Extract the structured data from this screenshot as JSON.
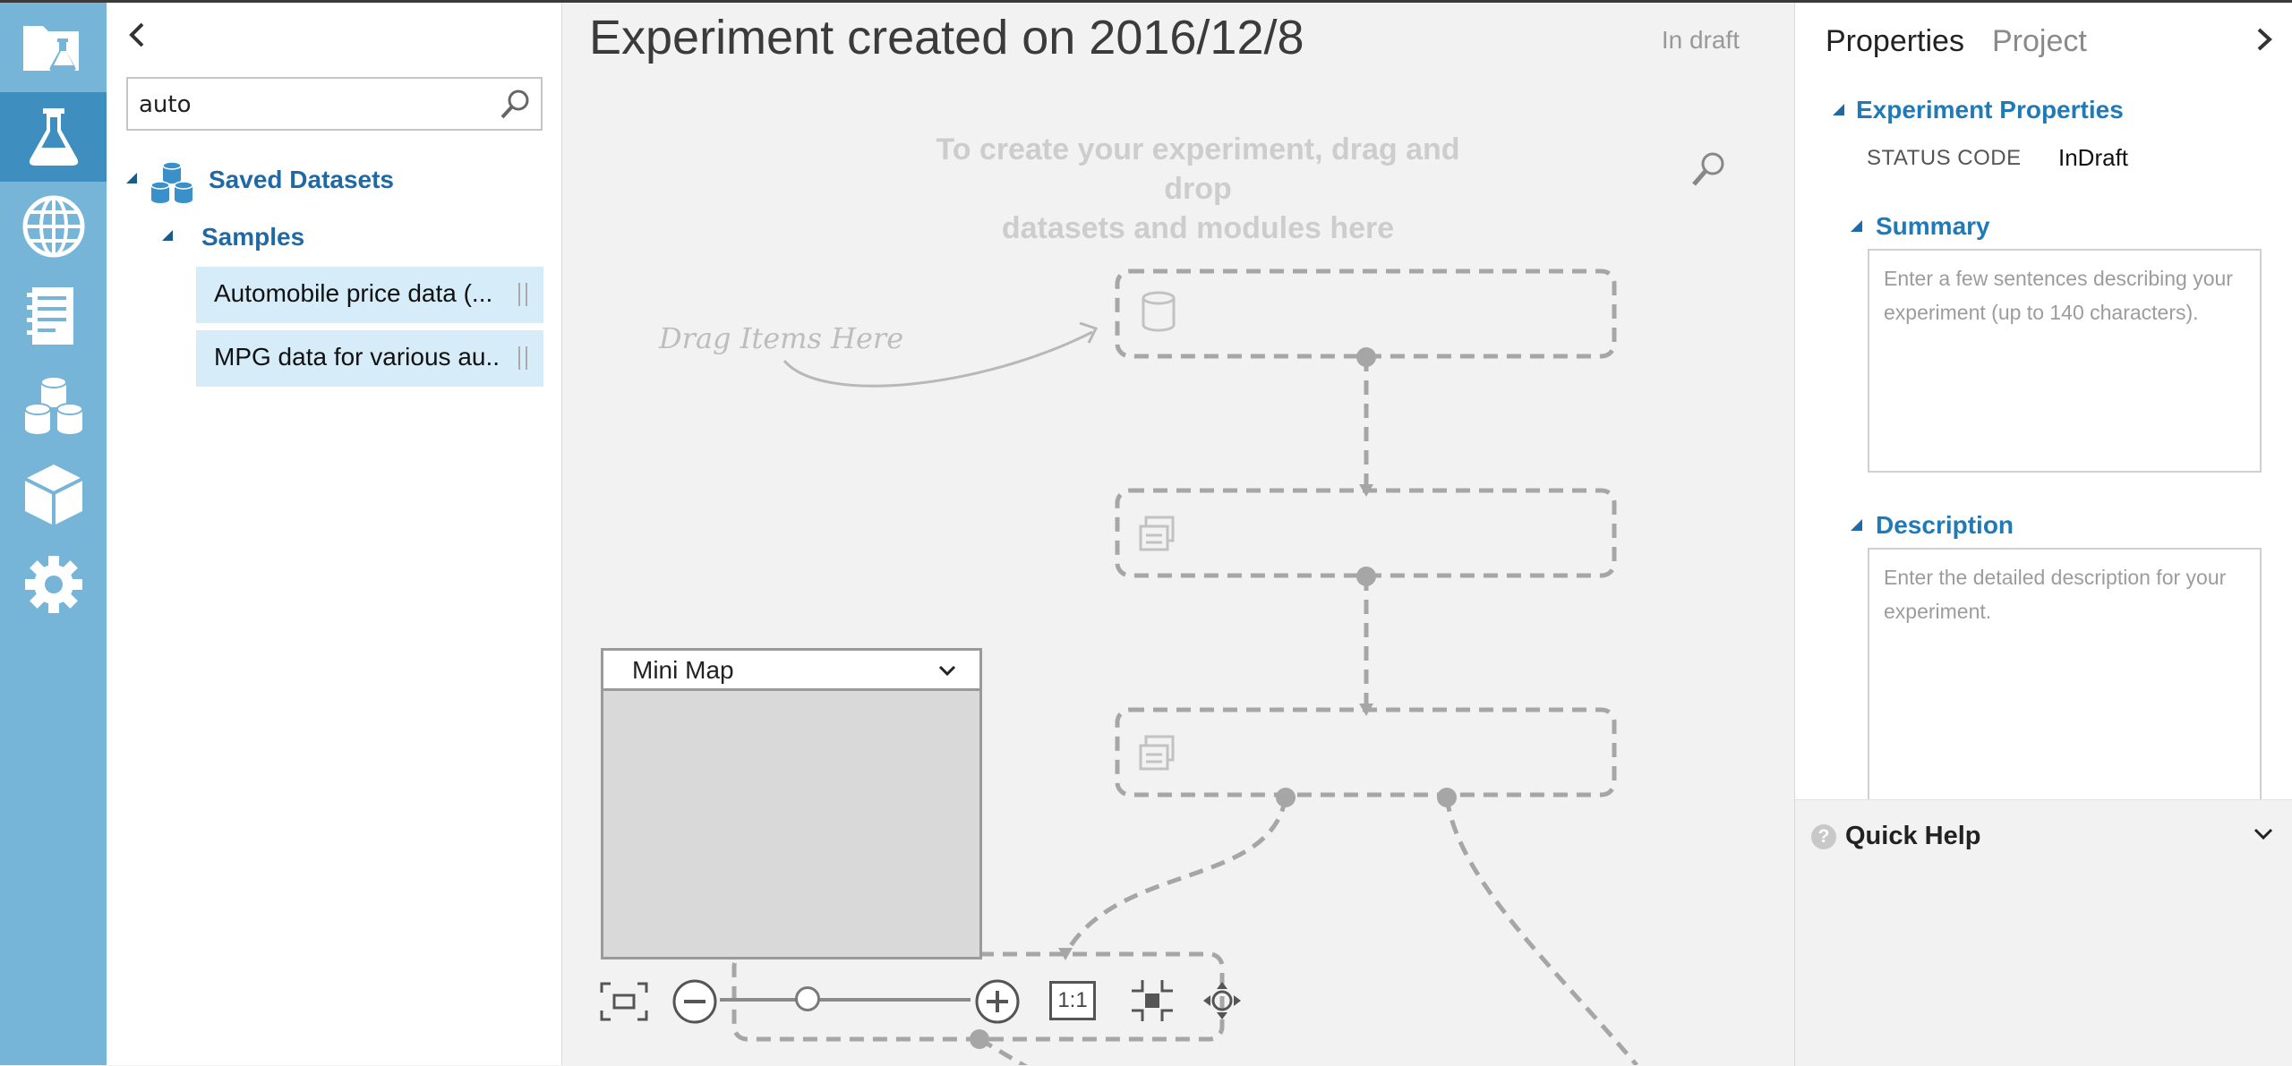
{
  "nav": {
    "items": [
      {
        "icon": "projects-icon"
      },
      {
        "icon": "experiments-icon",
        "active": true
      },
      {
        "icon": "web-services-icon"
      },
      {
        "icon": "notebooks-icon"
      },
      {
        "icon": "datasets-icon"
      },
      {
        "icon": "trained-models-icon"
      },
      {
        "icon": "settings-icon"
      }
    ]
  },
  "palette": {
    "search_value": "auto",
    "tree": {
      "root_label": "Saved Datasets",
      "child_label": "Samples",
      "items": [
        {
          "label": "Automobile price data (..."
        },
        {
          "label": "MPG data for various au..."
        }
      ]
    }
  },
  "canvas": {
    "title": "Experiment created on 2016/12/8",
    "status": "In draft",
    "hint_line1": "To create your experiment, drag and drop",
    "hint_line2": "datasets and modules here",
    "drag_hint": "Drag Items Here",
    "minimap_label": "Mini Map",
    "zoom_toolbar": {
      "fit_icon": "fit-to-screen-icon",
      "zoom_out_icon": "zoom-out-icon",
      "zoom_in_icon": "zoom-in-icon",
      "actual_size_label": "1:1",
      "center_icon": "center-icon",
      "pan_icon": "pan-icon",
      "zoom_level": 0.35
    }
  },
  "properties": {
    "tabs": [
      "Properties",
      "Project"
    ],
    "experiment_properties_label": "Experiment Properties",
    "status_code_key": "STATUS CODE",
    "status_code_value": "InDraft",
    "summary_label": "Summary",
    "summary_placeholder": "Enter a few sentences describing your experiment (up to 140 characters).",
    "description_label": "Description",
    "description_placeholder": "Enter the detailed description for your experiment.",
    "quick_help_label": "Quick Help"
  },
  "colors": {
    "rail_bg": "#76b5d8",
    "rail_active": "#3e8fbf",
    "link_blue": "#1f7ab8",
    "selected_item_bg": "#d6ecf9"
  }
}
